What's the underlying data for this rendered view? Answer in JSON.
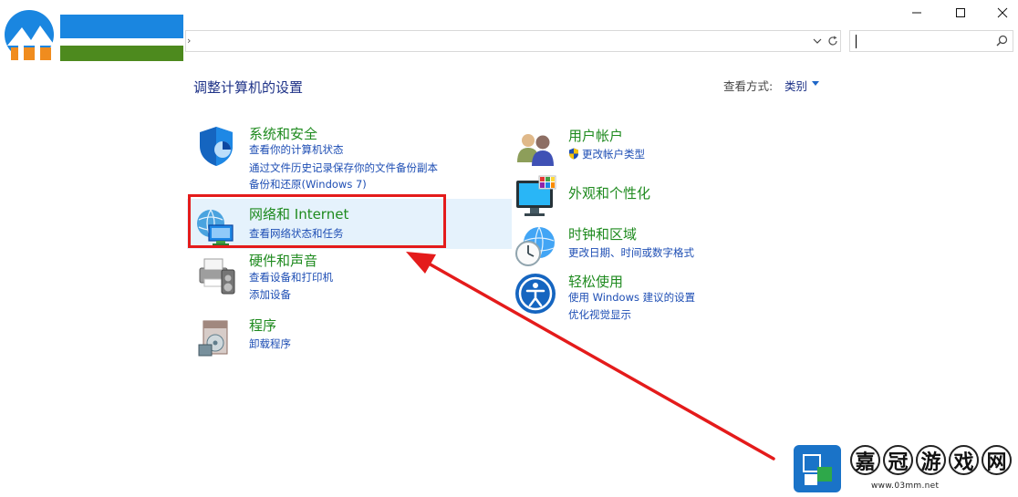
{
  "window": {
    "controls": [
      {
        "name": "minimize",
        "icon": "minimize-icon"
      },
      {
        "name": "maximize",
        "icon": "maximize-icon"
      },
      {
        "name": "close",
        "icon": "close-icon"
      }
    ]
  },
  "address": {
    "value": "",
    "chevron": "›"
  },
  "search": {
    "value": ""
  },
  "page": {
    "title": "调整计算机的设置",
    "view_by_label": "查看方式:",
    "view_by_value": "类别"
  },
  "categories": {
    "system_security": {
      "icon": "shield-icon",
      "title": "系统和安全",
      "links": [
        "查看你的计算机状态",
        "通过文件历史记录保存你的文件备份副本",
        "备份和还原(Windows 7)"
      ]
    },
    "network": {
      "icon": "network-globe-icon",
      "title": "网络和 Internet",
      "links": [
        "查看网络状态和任务"
      ]
    },
    "hardware_sound": {
      "icon": "printer-icon",
      "title": "硬件和声音",
      "links": [
        "查看设备和打印机",
        "添加设备"
      ]
    },
    "programs": {
      "icon": "programs-icon",
      "title": "程序",
      "links": [
        "卸载程序"
      ]
    },
    "user_accounts": {
      "icon": "users-icon",
      "title": "用户帐户",
      "links": [
        "更改帐户类型"
      ]
    },
    "appearance": {
      "icon": "monitor-palette-icon",
      "title": "外观和个性化",
      "links": []
    },
    "clock_region": {
      "icon": "clock-globe-icon",
      "title": "时钟和区域",
      "links": [
        "更改日期、时间或数字格式"
      ]
    },
    "ease_access": {
      "icon": "ease-of-access-icon",
      "title": "轻松使用",
      "links": [
        "使用 Windows 建议的设置",
        "优化视觉显示"
      ]
    }
  },
  "watermark": {
    "chars": [
      "嘉",
      "冠",
      "游",
      "戏",
      "网"
    ],
    "url": "www.03mm.net"
  },
  "colors": {
    "title_green": "#1e8a1e",
    "link_blue": "#1e4eb4",
    "heading_navy": "#1e3287",
    "highlight_bg": "#e5f2fc",
    "annotation_red": "#e41b1b"
  }
}
